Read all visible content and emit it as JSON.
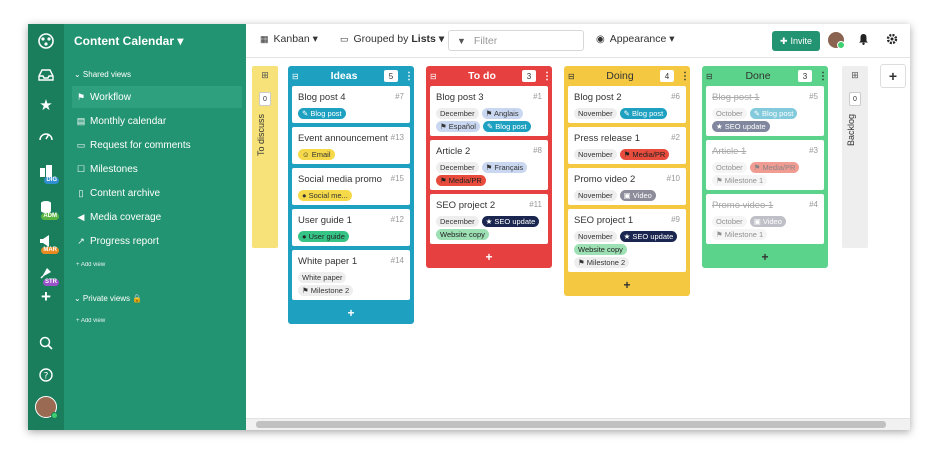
{
  "app": {
    "title": "Content Calendar ▾",
    "shared_views_label": "⌄ Shared views",
    "private_views_label": "⌄ Private views 🔒",
    "add_view_label": "+  Add view",
    "shared_views": [
      {
        "label": "Workflow",
        "icon": "hierarchy-icon"
      },
      {
        "label": "Monthly calendar",
        "icon": "calendar-icon"
      },
      {
        "label": "Request for comments",
        "icon": "form-icon"
      },
      {
        "label": "Milestones",
        "icon": "milestone-icon"
      },
      {
        "label": "Content archive",
        "icon": "archive-icon"
      },
      {
        "label": "Media coverage",
        "icon": "megaphone-icon"
      },
      {
        "label": "Progress report",
        "icon": "chart-icon"
      }
    ],
    "rail_badges": [
      "DIG",
      "ADM",
      "MAR",
      "STR"
    ]
  },
  "toolbar": {
    "view_label": "Kanban ▾",
    "group_prefix": "Grouped by",
    "group_value": "Lists ▾",
    "filter_placeholder": "Filter",
    "appearance_label": "Appearance ▾",
    "invite_label": "Invite"
  },
  "collapsed_lists": [
    {
      "label": "To discuss",
      "count": "0"
    },
    {
      "label": "Backlog",
      "count": "0"
    }
  ],
  "columns": [
    {
      "name": "Ideas",
      "count": "5",
      "color": "#1ea1c1",
      "cards": [
        {
          "title": "Blog post 4",
          "num": "#7",
          "tags": [
            {
              "text": "✎ Blog post",
              "bg": "#1ea1c1",
              "fg": "#fff"
            }
          ]
        },
        {
          "title": "Event announcement",
          "num": "#13",
          "tags": [
            {
              "text": "☺ Email",
              "bg": "#f5d94a",
              "fg": "#333"
            }
          ]
        },
        {
          "title": "Social media promo",
          "num": "#15",
          "tags": [
            {
              "text": "● Social me...",
              "bg": "#f5d94a",
              "fg": "#333"
            }
          ]
        },
        {
          "title": "User guide 1",
          "num": "#12",
          "tags": [
            {
              "text": "● User guide",
              "bg": "#36c486",
              "fg": "#222"
            }
          ]
        },
        {
          "title": "White paper 1",
          "num": "#14",
          "tags": [
            {
              "text": "White paper",
              "bg": "#eeeeee",
              "fg": "#333"
            },
            {
              "text": "⚑ Milestone 2",
              "bg": "#eeeeee",
              "fg": "#333"
            }
          ]
        }
      ]
    },
    {
      "name": "To do",
      "count": "3",
      "color": "#e74040",
      "cards": [
        {
          "title": "Blog post 3",
          "num": "#1",
          "tags": [
            {
              "text": "December",
              "bg": "#eeeeee",
              "fg": "#333"
            },
            {
              "text": "⚑ Anglais",
              "bg": "#c9d7f0",
              "fg": "#333"
            },
            {
              "text": "⚑ Español",
              "bg": "#c9d7f0",
              "fg": "#333"
            },
            {
              "text": "✎ Blog post",
              "bg": "#1ea1c1",
              "fg": "#fff"
            }
          ]
        },
        {
          "title": "Article 2",
          "num": "#8",
          "tags": [
            {
              "text": "December",
              "bg": "#eeeeee",
              "fg": "#333"
            },
            {
              "text": "⚑ Français",
              "bg": "#c9d7f0",
              "fg": "#333"
            },
            {
              "text": "⚑ Media/PR",
              "bg": "#e74c3c",
              "fg": "#222"
            }
          ]
        },
        {
          "title": "SEO project 2",
          "num": "#11",
          "tags": [
            {
              "text": "December",
              "bg": "#eeeeee",
              "fg": "#333"
            },
            {
              "text": "★ SEO update",
              "bg": "#1a2650",
              "fg": "#fff"
            },
            {
              "text": "Website copy",
              "bg": "#9de0b4",
              "fg": "#222"
            }
          ]
        }
      ]
    },
    {
      "name": "Doing",
      "count": "4",
      "color": "#f5c842",
      "cards": [
        {
          "title": "Blog post 2",
          "num": "#6",
          "tags": [
            {
              "text": "November",
              "bg": "#eeeeee",
              "fg": "#333"
            },
            {
              "text": "✎ Blog post",
              "bg": "#1ea1c1",
              "fg": "#fff"
            }
          ]
        },
        {
          "title": "Press release 1",
          "num": "#2",
          "tags": [
            {
              "text": "November",
              "bg": "#eeeeee",
              "fg": "#333"
            },
            {
              "text": "⚑ Media/PR",
              "bg": "#e74c3c",
              "fg": "#222"
            }
          ]
        },
        {
          "title": "Promo video 2",
          "num": "#10",
          "tags": [
            {
              "text": "November",
              "bg": "#eeeeee",
              "fg": "#333"
            },
            {
              "text": "▣ Video",
              "bg": "#8c8c9a",
              "fg": "#fff"
            }
          ]
        },
        {
          "title": "SEO project 1",
          "num": "#9",
          "tags": [
            {
              "text": "November",
              "bg": "#eeeeee",
              "fg": "#333"
            },
            {
              "text": "★ SEO update",
              "bg": "#1a2650",
              "fg": "#fff"
            },
            {
              "text": "Website copy",
              "bg": "#9de0b4",
              "fg": "#222"
            },
            {
              "text": "⚑ Milestone 2",
              "bg": "#eeeeee",
              "fg": "#333"
            }
          ]
        }
      ]
    },
    {
      "name": "Done",
      "count": "3",
      "color": "#5cd38a",
      "cards": [
        {
          "title": "Blog post 1",
          "num": "#5",
          "tags": [
            {
              "text": "October",
              "bg": "#eeeeee",
              "fg": "#333"
            },
            {
              "text": "✎ Blog post",
              "bg": "#1ea1c1",
              "fg": "#fff"
            },
            {
              "text": "★ SEO update",
              "bg": "#1a2650",
              "fg": "#fff"
            }
          ]
        },
        {
          "title": "Article 1",
          "num": "#3",
          "tags": [
            {
              "text": "October",
              "bg": "#eeeeee",
              "fg": "#333"
            },
            {
              "text": "⚑ Media/PR",
              "bg": "#e74c3c",
              "fg": "#222"
            },
            {
              "text": "⚑ Milestone 1",
              "bg": "#eeeeee",
              "fg": "#333"
            }
          ]
        },
        {
          "title": "Promo video 1",
          "num": "#4",
          "tags": [
            {
              "text": "October",
              "bg": "#eeeeee",
              "fg": "#333"
            },
            {
              "text": "▣ Video",
              "bg": "#8c8c9a",
              "fg": "#fff"
            },
            {
              "text": "⚑ Milestone 1",
              "bg": "#eeeeee",
              "fg": "#333"
            }
          ]
        }
      ]
    }
  ]
}
